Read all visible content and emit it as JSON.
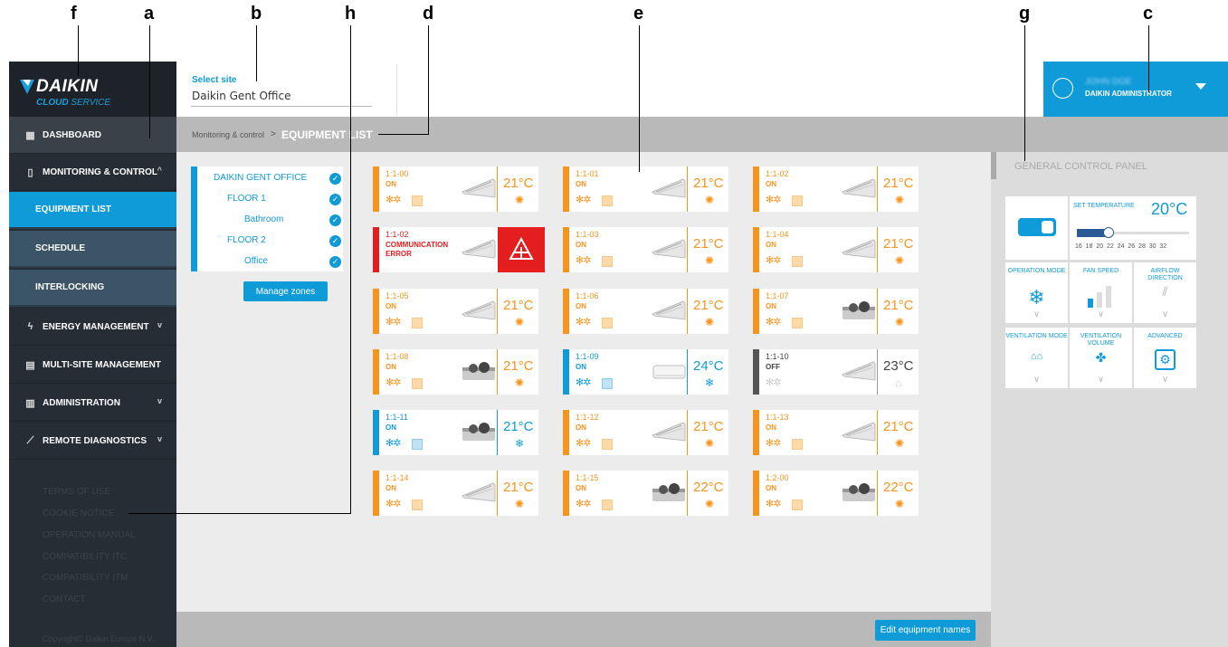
{
  "callouts": {
    "a": "a",
    "b": "b",
    "c": "c",
    "d": "d",
    "e": "e",
    "f": "f",
    "g": "g",
    "h": "h"
  },
  "brand": {
    "name": "DAIKIN",
    "sub_bold": "CLOUD",
    "sub_light": "SERVICE"
  },
  "nav": [
    {
      "label": "DASHBOARD",
      "icon": "dashboard-icon"
    },
    {
      "label": "MONITORING & CONTROL",
      "icon": "remote-icon",
      "chevron": "^"
    },
    {
      "label": "EQUIPMENT LIST"
    },
    {
      "label": "SCHEDULE"
    },
    {
      "label": "INTERLOCKING"
    },
    {
      "label": "ENERGY MANAGEMENT",
      "icon": "lightning-icon",
      "chevron": "v"
    },
    {
      "label": "MULTI-SITE MANAGEMENT",
      "icon": "document-icon"
    },
    {
      "label": "ADMINISTRATION",
      "icon": "building-icon",
      "chevron": "v"
    },
    {
      "label": "REMOTE DIAGNOSTICS",
      "icon": "wrench-icon",
      "chevron": "v"
    }
  ],
  "footer_links": [
    "TERMS OF USE",
    "COOKIE NOTICE",
    "OPERATION MANUAL",
    "COMPATIBILITY ITC",
    "COMPATIBILITY ITM",
    "CONTACT"
  ],
  "copyright": "Copyright© Daikin Europe N.V.",
  "site": {
    "label": "Select site",
    "value": "Daikin Gent Office"
  },
  "user": {
    "name": "JOHN DOE",
    "role": "DAIKIN ADMINISTRATOR"
  },
  "breadcrumb": {
    "parent": "Monitoring & control",
    "sep": ">",
    "current": "EQUIPMENT LIST"
  },
  "zones": [
    {
      "label": "DAIKIN GENT OFFICE",
      "check": "✓"
    },
    {
      "label": "FLOOR 1",
      "check": "✓"
    },
    {
      "label": "Bathroom",
      "check": "✓"
    },
    {
      "label": "FLOOR 2",
      "check": "✓"
    },
    {
      "label": "Office",
      "check": "✓"
    }
  ],
  "manage_zones": "Manage zones",
  "edit_names": "Edit equipment names",
  "equipment": [
    {
      "id": "1:1-00",
      "status": "ON",
      "temp": "21°C",
      "mode": "heat",
      "unit": "cassette"
    },
    {
      "id": "1:1-01",
      "status": "ON",
      "temp": "21°C",
      "mode": "heat",
      "unit": "cassette"
    },
    {
      "id": "1:1-02",
      "status": "ON",
      "temp": "21°C",
      "mode": "heat",
      "unit": "cassette"
    },
    {
      "id": "1:1-02",
      "status": "COMMUNICATION ERROR",
      "temp": "",
      "mode": "error",
      "unit": "cassette"
    },
    {
      "id": "1:1-03",
      "status": "ON",
      "temp": "21°C",
      "mode": "heat",
      "unit": "cassette"
    },
    {
      "id": "1:1-04",
      "status": "ON",
      "temp": "21°C",
      "mode": "heat",
      "unit": "cassette"
    },
    {
      "id": "1:1-05",
      "status": "ON",
      "temp": "21°C",
      "mode": "heat",
      "unit": "cassette"
    },
    {
      "id": "1:1-06",
      "status": "ON",
      "temp": "21°C",
      "mode": "heat",
      "unit": "cassette"
    },
    {
      "id": "1:1-07",
      "status": "ON",
      "temp": "21°C",
      "mode": "heat",
      "unit": "duct"
    },
    {
      "id": "1:1-08",
      "status": "ON",
      "temp": "21°C",
      "mode": "heat",
      "unit": "duct"
    },
    {
      "id": "1:1-09",
      "status": "ON",
      "temp": "24°C",
      "mode": "cool",
      "unit": "wall"
    },
    {
      "id": "1:1-10",
      "status": "OFF",
      "temp": "23°C",
      "mode": "off",
      "unit": "cassette"
    },
    {
      "id": "1:1-11",
      "status": "ON",
      "temp": "21°C",
      "mode": "cool",
      "unit": "duct"
    },
    {
      "id": "1:1-12",
      "status": "ON",
      "temp": "21°C",
      "mode": "heat",
      "unit": "cassette"
    },
    {
      "id": "1:1-13",
      "status": "ON",
      "temp": "21°C",
      "mode": "heat",
      "unit": "cassette"
    },
    {
      "id": "1:1-14",
      "status": "ON",
      "temp": "21°C",
      "mode": "heat",
      "unit": "cassette"
    },
    {
      "id": "1:1-15",
      "status": "ON",
      "temp": "22°C",
      "mode": "heat",
      "unit": "duct"
    },
    {
      "id": "1:2-00",
      "status": "ON",
      "temp": "22°C",
      "mode": "heat",
      "unit": "duct"
    }
  ],
  "panel": {
    "title": "GENERAL CONTROL PANEL",
    "set_temp_label": "SET TEMPERATURE",
    "set_temp_value": "20°C",
    "slider_ticks": "16  18  20  22  24  26  28  30  32",
    "tiles": [
      {
        "label": "OPERATION MODE",
        "icon": "snowflake-icon"
      },
      {
        "label": "FAN SPEED",
        "icon": "fan-speed-icon"
      },
      {
        "label": "AIRFLOW DIRECTION",
        "icon": "airflow-icon"
      },
      {
        "label": "VENTILATION MODE",
        "icon": "ventilation-mode-icon"
      },
      {
        "label": "VENTILATION VOLUME",
        "icon": "ventilation-volume-icon"
      },
      {
        "label": "ADVANCED",
        "icon": "advanced-icon"
      }
    ],
    "chevron": "∨"
  },
  "colors": {
    "accent": "#0f9ad8",
    "heat": "#f7941d",
    "error": "#e41e1e",
    "sidebar": "#262d35"
  }
}
